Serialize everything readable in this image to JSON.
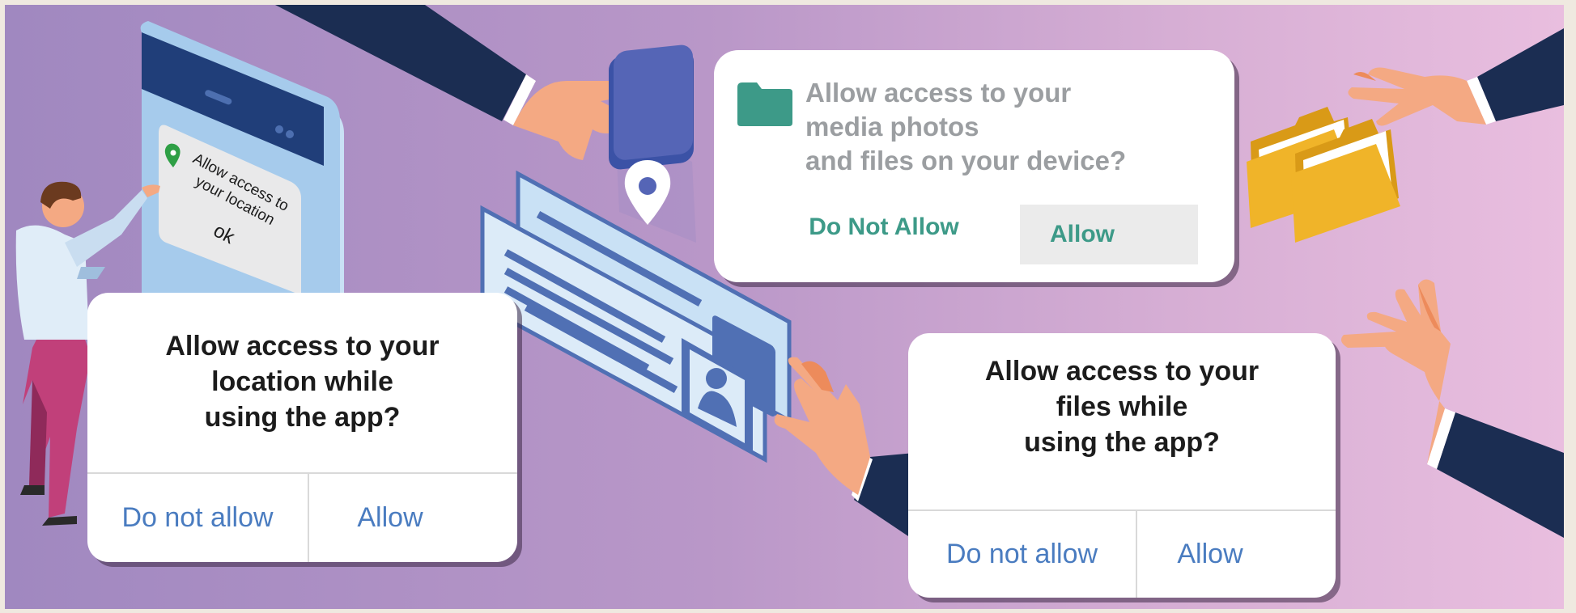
{
  "location_dialog": {
    "title_lines": [
      "Allow access to your",
      "location while",
      "using the app?"
    ],
    "deny_label": "Do not allow",
    "allow_label": "Allow"
  },
  "files_dialog": {
    "title_lines": [
      "Allow access to your",
      "files while",
      "using the app?"
    ],
    "deny_label": "Do not allow",
    "allow_label": "Allow"
  },
  "media_dialog": {
    "message_lines": [
      "Allow access to your",
      "media photos",
      "and files on your device?"
    ],
    "deny_label": "Do Not Allow",
    "allow_label": "Allow"
  },
  "phone_popup": {
    "text_lines": [
      "Allow access to",
      "your location"
    ],
    "ok_label": "ok"
  },
  "colors": {
    "accent_teal": "#3d9a88",
    "link_blue": "#4a7cc0",
    "sleeve_navy": "#1b2d52",
    "hand_skin": "#f4a983",
    "folder_yellow": "#f0b429"
  },
  "icons": [
    "folder-icon",
    "location-pin-icon",
    "user-profile-icon",
    "folder-pair-icon"
  ]
}
